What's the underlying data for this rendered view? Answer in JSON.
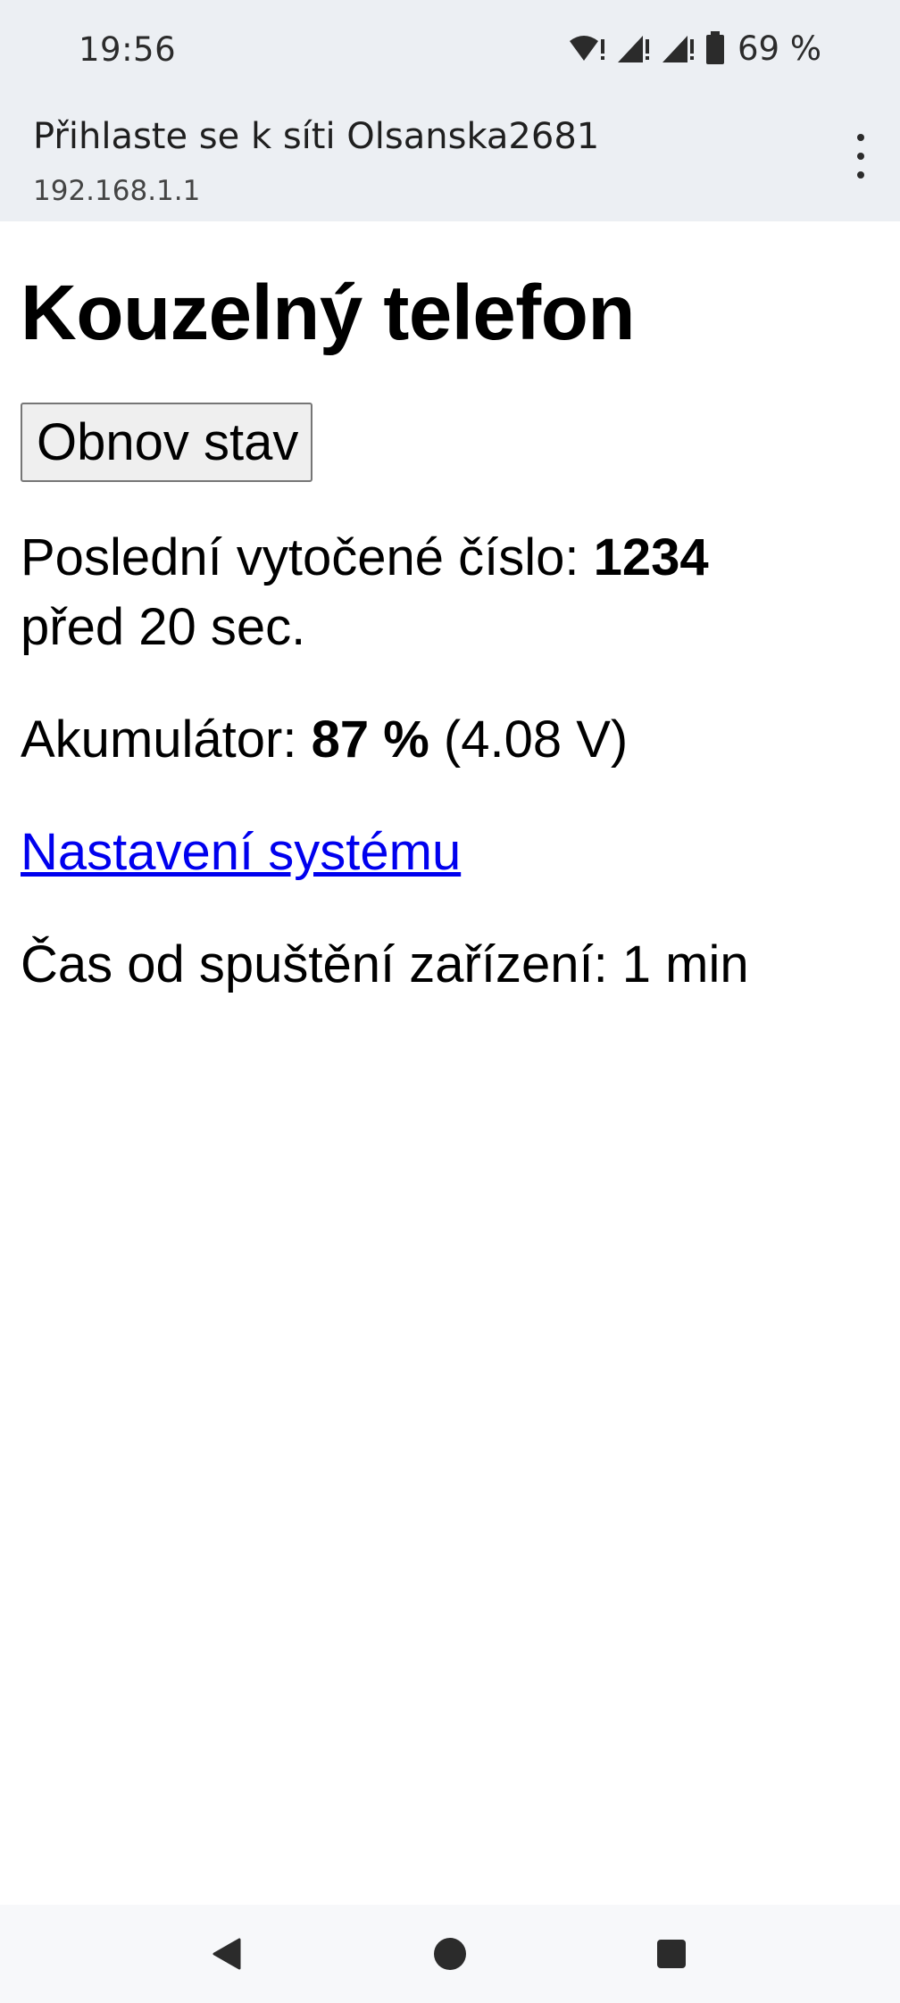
{
  "status_bar": {
    "time": "19:56",
    "battery_percent": "69 %",
    "icons": [
      "wifi-icon",
      "signal-icon",
      "signal-icon",
      "battery-icon"
    ]
  },
  "portal": {
    "title": "Přihlaste se k síti Olsanska2681",
    "url": "192.168.1.1",
    "menu_icon": "more-vert-icon"
  },
  "page": {
    "title": "Kouzelný telefon",
    "refresh_button": "Obnov stav",
    "last_dial_label": "Poslední vytočené číslo: ",
    "last_dial_number": "1234",
    "last_dial_ago": "před 20 sec.",
    "battery_label": "Akumulátor: ",
    "battery_percent": "87 %",
    "battery_voltage": " (4.08 V)",
    "settings_link": "Nastavení systému",
    "uptime_text": "Čas od spuštění zařízení: 1 min"
  },
  "nav": {
    "back_icon": "back-triangle-icon",
    "home_icon": "home-circle-icon",
    "recents_icon": "recents-square-icon"
  },
  "colors": {
    "header_bg": "#eceff3",
    "link": "#0000ee"
  }
}
